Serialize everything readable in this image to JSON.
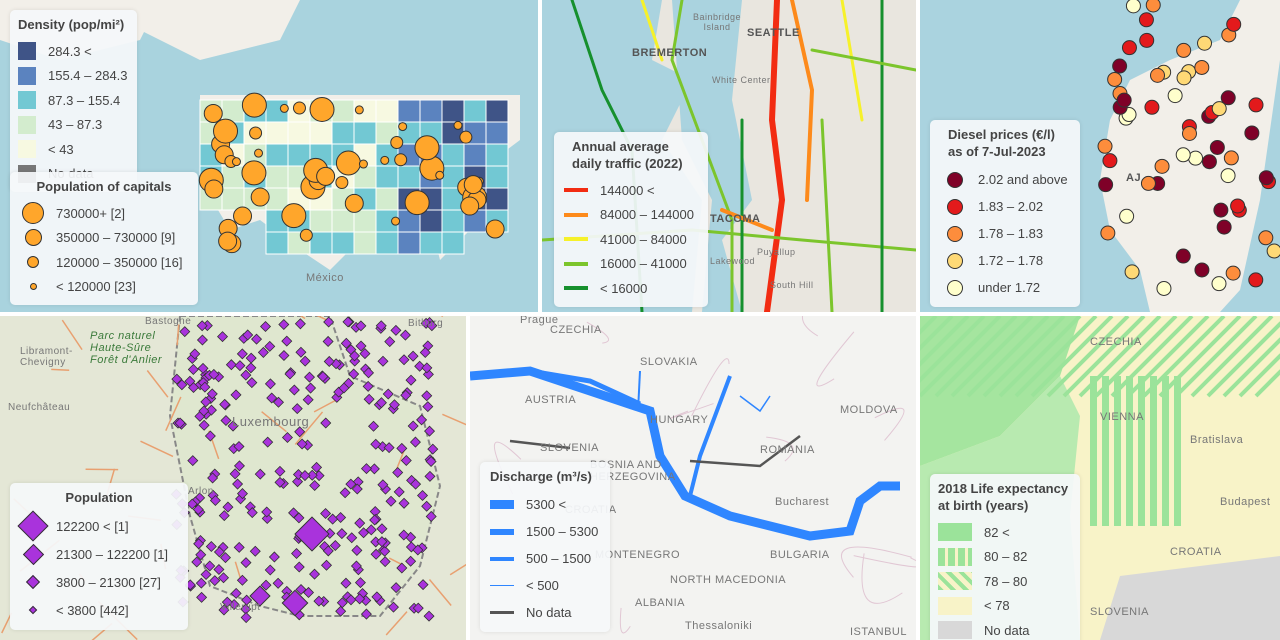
{
  "us_density": {
    "density_legend": {
      "title": "Density (pop/mi²)",
      "items": [
        {
          "label": "284.3 <",
          "color": "#3f5487"
        },
        {
          "label": "155.4 – 284.3",
          "color": "#5b83bf"
        },
        {
          "label": "87.3 – 155.4",
          "color": "#72c8d3"
        },
        {
          "label": "43 – 87.3",
          "color": "#d3ecce"
        },
        {
          "label": "< 43",
          "color": "#f7f9e1"
        },
        {
          "label": "No data",
          "color": "#777777"
        }
      ]
    },
    "population_legend": {
      "title": "Population of capitals",
      "items": [
        {
          "label": "730000+ [2]"
        },
        {
          "label": "350000 – 730000 [9]"
        },
        {
          "label": "120000 – 350000 [16]"
        },
        {
          "label": "< 120000 [23]"
        }
      ],
      "color": "#ffa62b"
    },
    "labels": {
      "mexico": "México"
    }
  },
  "seattle_traffic": {
    "legend": {
      "title": "Annual average daily traffic (2022)",
      "items": [
        {
          "label": "144000 <",
          "color": "#f22c12"
        },
        {
          "label": "84000 – 144000",
          "color": "#fd8a1b"
        },
        {
          "label": "41000 – 84000",
          "color": "#f6f12a"
        },
        {
          "label": "16000 – 41000",
          "color": "#7cc52c"
        },
        {
          "label": "< 16000",
          "color": "#16902e"
        }
      ]
    },
    "labels": {
      "bremerton": "BREMERTON",
      "seattle": "SEATTLE",
      "bainbridge": "Bainbridge Island",
      "white_center": "White Center",
      "tacoma": "TACOMA",
      "puyallup": "Puyallup",
      "south_hill": "South Hill",
      "lakewood": "Lakewood"
    }
  },
  "corsica_diesel": {
    "legend": {
      "title": "Diesel prices (€/l) as of 7-Jul-2023",
      "items": [
        {
          "label": "2.02 and above",
          "color": "#7f0128"
        },
        {
          "label": "1.83 – 2.02",
          "color": "#e31a1c"
        },
        {
          "label": "1.78 – 1.83",
          "color": "#fd8d3c"
        },
        {
          "label": "1.72 – 1.78",
          "color": "#fed976"
        },
        {
          "label": "under 1.72",
          "color": "#ffffcc"
        }
      ]
    },
    "labels": {
      "ajaccio": "AJ"
    }
  },
  "luxembourg_population": {
    "legend": {
      "title": "Population",
      "items": [
        {
          "label": "122200 < [1]"
        },
        {
          "label": "21300 – 122200 [1]"
        },
        {
          "label": "3800 – 21300 [27]"
        },
        {
          "label": "< 3800 [442]"
        }
      ],
      "color": "#a933dc"
    },
    "labels": {
      "bastogne": "Bastogne",
      "libramont": "Libramont-Chevigny",
      "parc": "Parc naturel Haute-Sûre Forêt d'Anlier",
      "neufchateau": "Neufchâteau",
      "bitburg": "Bitburg",
      "luxembourg": "Luxembourg",
      "arlon": "Arlon",
      "villerupt": "Villerupt"
    }
  },
  "danube_discharge": {
    "legend": {
      "title": "Discharge (m³/s)",
      "items": [
        {
          "label": "5300 <",
          "width": 9
        },
        {
          "label": "1500 – 5300",
          "width": 6
        },
        {
          "label": "500 – 1500",
          "width": 4
        },
        {
          "label": "< 500",
          "width": 1.5
        },
        {
          "label": "No data",
          "width": 2.5,
          "color": "#555555"
        }
      ],
      "color": "#2f86ff"
    },
    "labels": {
      "prague": "Prague",
      "czechia": "CZECHIA",
      "slovakia": "SLOVAKIA",
      "austria": "AUSTRIA",
      "hungary": "HUNGARY",
      "moldova": "MOLDOVA",
      "romania": "ROMANIA",
      "slovenia": "SLOVENIA",
      "bosnia": "BOSNIA AND HERZEGOVINA",
      "bucharest": "Bucharest",
      "montenegro": "MONTENEGRO",
      "bulgaria": "BULGARIA",
      "north_macedonia": "NORTH MACEDONIA",
      "albania": "ALBANIA",
      "istanbul": "ISTANBUL",
      "thessaloniki": "Thessaloniki",
      "croatia": "CROATIA"
    }
  },
  "italy_life_expectancy": {
    "legend": {
      "title": "2018 Life expectancy at birth (years)",
      "items": [
        {
          "label": "82 <",
          "pattern": "solid"
        },
        {
          "label": "80 – 82",
          "pattern": "vertical"
        },
        {
          "label": "78 – 80",
          "pattern": "diagonal"
        },
        {
          "label": "< 78",
          "pattern": "light"
        },
        {
          "label": "No data",
          "pattern": "nodata"
        }
      ]
    },
    "labels": {
      "vienna": "VIENNA",
      "bratislava": "Bratislava",
      "budapest": "Budapest",
      "croatia": "CROATIA",
      "slovenia": "SLOVENIA",
      "czechia": "CZECHIA"
    }
  }
}
